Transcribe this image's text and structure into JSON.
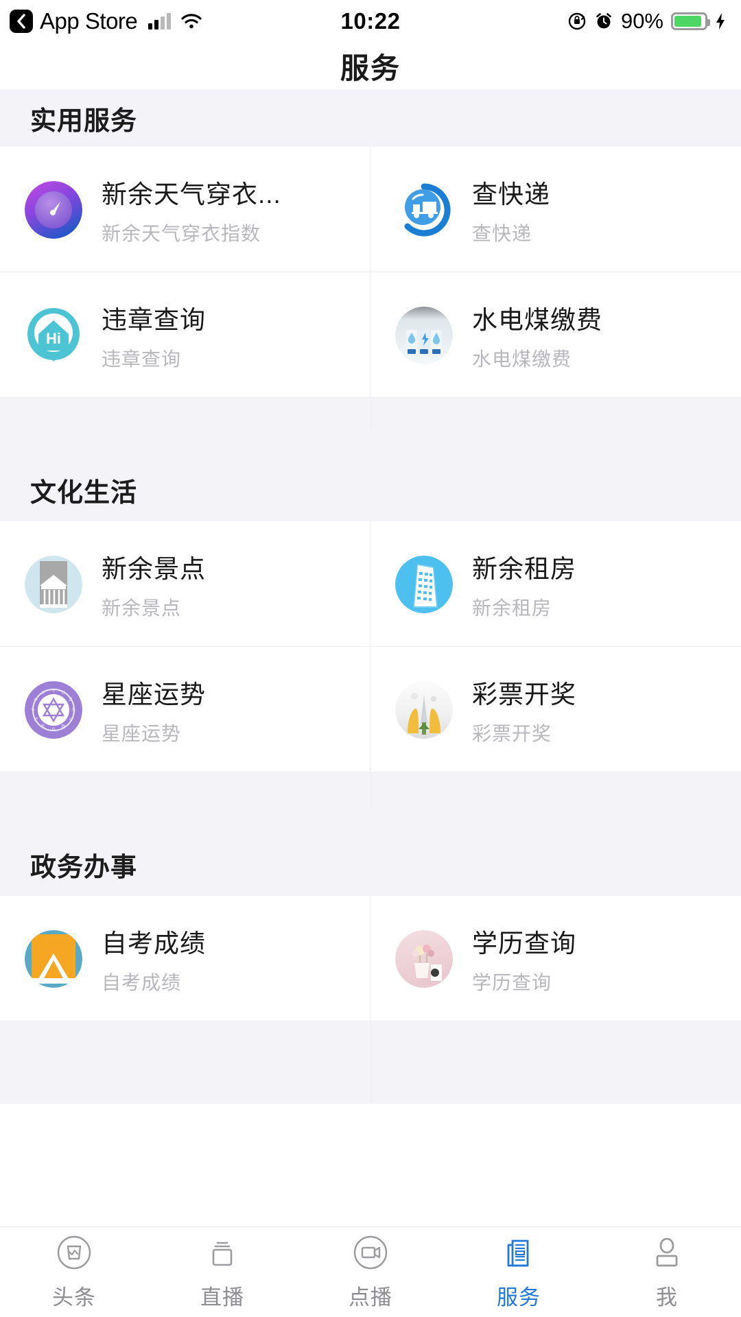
{
  "status_bar": {
    "back_label": "App Store",
    "back_icon": "chevron-left-icon",
    "signal_icon": "cellular-signal-icon",
    "wifi_icon": "wifi-icon",
    "time": "10:22",
    "rotation_lock_icon": "rotation-lock-icon",
    "alarm_icon": "alarm-clock-icon",
    "battery_percent": "90%",
    "battery_level": 90,
    "battery_color": "#4cd663",
    "charging_icon": "lightning-bolt-icon"
  },
  "navbar": {
    "title": "服务"
  },
  "sections": [
    {
      "label": "实用服务",
      "items": [
        {
          "title": "新余天气穿衣...",
          "subtitle": "新余天气穿衣指数",
          "icon": "weather-gauge-icon"
        },
        {
          "title": "查快递",
          "subtitle": "查快递",
          "icon": "delivery-truck-search-icon"
        },
        {
          "title": "违章查询",
          "subtitle": "违章查询",
          "icon": "hi-house-icon"
        },
        {
          "title": "水电煤缴费",
          "subtitle": "水电煤缴费",
          "icon": "utilities-meter-icon"
        }
      ]
    },
    {
      "label": "文化生活",
      "items": [
        {
          "title": "新余景点",
          "subtitle": "新余景点",
          "icon": "temple-landmark-icon"
        },
        {
          "title": "新余租房",
          "subtitle": "新余租房",
          "icon": "apartment-building-icon"
        },
        {
          "title": "星座运势",
          "subtitle": "星座运势",
          "icon": "zodiac-wheel-icon"
        },
        {
          "title": "彩票开奖",
          "subtitle": "彩票开奖",
          "icon": "lottery-ticket-icon"
        }
      ]
    },
    {
      "label": "政务办事",
      "items": [
        {
          "title": "自考成绩",
          "subtitle": "自考成绩",
          "icon": "mountain-photo-icon"
        },
        {
          "title": "学历查询",
          "subtitle": "学历查询",
          "icon": "flower-vase-photo-icon"
        }
      ]
    }
  ],
  "tabbar": {
    "active_color": "#2079d8",
    "inactive_color": "#8d8d93",
    "tabs": [
      {
        "label": "头条",
        "icon": "headlines-icon",
        "active": false
      },
      {
        "label": "直播",
        "icon": "live-stream-icon",
        "active": false
      },
      {
        "label": "点播",
        "icon": "video-on-demand-icon",
        "active": false
      },
      {
        "label": "服务",
        "icon": "services-newspaper-icon",
        "active": true
      },
      {
        "label": "我",
        "icon": "profile-person-icon",
        "active": false
      }
    ]
  }
}
